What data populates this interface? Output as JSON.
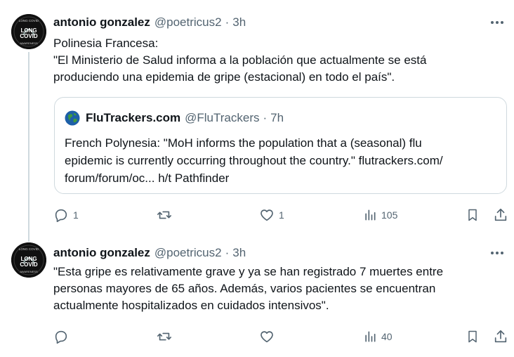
{
  "tweets": [
    {
      "author_name": "antonio gonzalez",
      "handle": "@poetricus2",
      "separator": "·",
      "time": "3h",
      "lines": [
        "Polinesia Francesa:",
        "\"El Ministerio de Salud informa a la población que actualmente se está",
        "produciendo una epidemia de gripe (estacional) en todo el país\"."
      ],
      "quote": {
        "author_name": "FluTrackers.com",
        "handle": "@FluTrackers",
        "separator": "·",
        "time": "7h",
        "lines": [
          "French Polynesia: \"MoH informs the population that a (seasonal) flu",
          "epidemic is currently occurring throughout the country.\" flutrackers.com/",
          "forum/forum/oc... h/t Pathfinder"
        ]
      },
      "actions": {
        "replies": "1",
        "retweets": "",
        "likes": "1",
        "views": "105"
      }
    },
    {
      "author_name": "antonio gonzalez",
      "handle": "@poetricus2",
      "separator": "·",
      "time": "3h",
      "lines": [
        "\"Esta gripe es relativamente grave y ya se han registrado 7 muertes entre",
        "personas mayores de 65 años. Además, varios pacientes se encuentran",
        "actualmente hospitalizados en cuidados intensivos\"."
      ],
      "actions": {
        "replies": "",
        "retweets": "",
        "likes": "",
        "views": "40"
      }
    }
  ],
  "avatar_badge": {
    "top_text": "LONG COVID",
    "line1": "LONG",
    "line2": "COVID",
    "bottom_text": "AWARENESS"
  },
  "colors": {
    "text": "#0f1419",
    "secondary": "#536471",
    "border": "#cfd9de"
  }
}
